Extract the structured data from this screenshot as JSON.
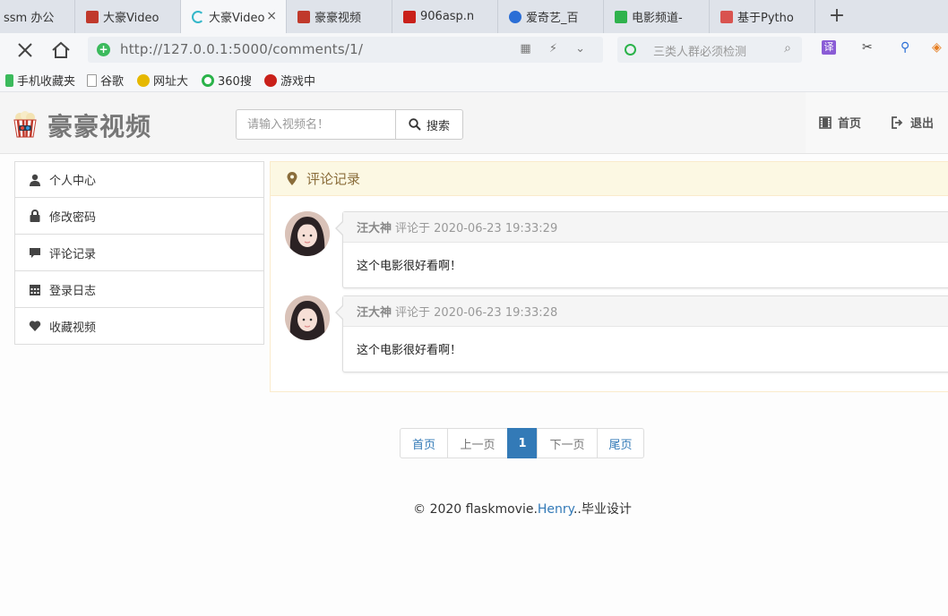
{
  "browser": {
    "tabs": [
      {
        "label": "ssm 办公",
        "color": "#dfe3ea"
      },
      {
        "label": "大豪Video",
        "color": "#c0392b"
      },
      {
        "label": "大豪Video",
        "color": "#35b7c9",
        "active": true
      },
      {
        "label": "豪豪视频",
        "color": "#c0392b"
      },
      {
        "label": "906asp.n",
        "color": "#c9201a"
      },
      {
        "label": "爱奇艺_百",
        "color": "#2a6ed6"
      },
      {
        "label": "电影频道-",
        "color": "#2fb24c"
      },
      {
        "label": "基于Pytho",
        "color": "#d9534f"
      }
    ],
    "tab_close": "×",
    "new_tab": "+",
    "url": "http://127.0.0.1:5000/comments/1/",
    "search_placeholder": "三类人群必须检测",
    "bookmarks": [
      {
        "label": "手机收藏夹",
        "color": "#3bba5c"
      },
      {
        "label": "谷歌",
        "color": "#cccccc"
      },
      {
        "label": "网址大",
        "color": "#e6b800"
      },
      {
        "label": "360搜",
        "color": "#2bb34a"
      },
      {
        "label": "游戏中",
        "color": "#c9201a"
      }
    ]
  },
  "header": {
    "site_name": "豪豪视频",
    "search_placeholder": "请输入视频名！",
    "search_button": "搜索",
    "nav_home": "首页",
    "nav_logout": "退出"
  },
  "sidebar": {
    "items": [
      {
        "label": "个人中心",
        "icon": "user-icon"
      },
      {
        "label": "修改密码",
        "icon": "lock-icon"
      },
      {
        "label": "评论记录",
        "icon": "comment-icon"
      },
      {
        "label": "登录日志",
        "icon": "calendar-icon"
      },
      {
        "label": "收藏视频",
        "icon": "heart-icon"
      }
    ]
  },
  "panel": {
    "title": "评论记录",
    "comments": [
      {
        "user": "汪大神",
        "meta": "评论于 2020-06-23 19:33:29",
        "content": "这个电影很好看啊！"
      },
      {
        "user": "汪大神",
        "meta": "评论于 2020-06-23 19:33:28",
        "content": "这个电影很好看啊！"
      }
    ]
  },
  "pagination": {
    "first": "首页",
    "prev": "上一页",
    "current": "1",
    "next": "下一页",
    "last": "尾页"
  },
  "footer": {
    "prefix": "© 2020 flaskmovie.",
    "highlight": "Henry",
    "suffix": "..毕业设计"
  },
  "colors": {
    "accent": "#337ab7",
    "panel_warning_bg": "#fcf8e3",
    "panel_warning_text": "#8a6d3b"
  }
}
